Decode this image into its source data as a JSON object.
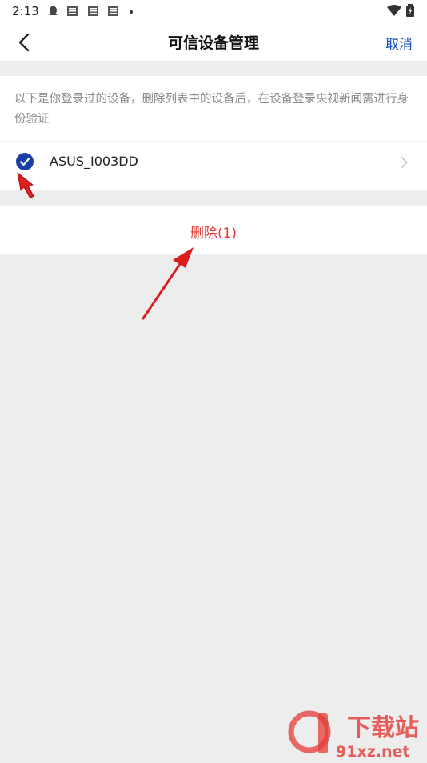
{
  "status_bar": {
    "time": "2:13"
  },
  "header": {
    "title": "可信设备管理",
    "cancel_label": "取消"
  },
  "main": {
    "description": "以下是你登录过的设备，删除列表中的设备后，在设备登录央视新闻需进行身份验证",
    "devices": [
      {
        "name": "ASUS_I003DD",
        "selected": true
      }
    ],
    "delete_label": "删除(1)"
  },
  "watermark": {
    "text_main": "下载站",
    "text_sub": "91xz.net"
  },
  "colors": {
    "accent": "#1a3fa8",
    "danger": "#e53935",
    "background": "#ededed"
  }
}
